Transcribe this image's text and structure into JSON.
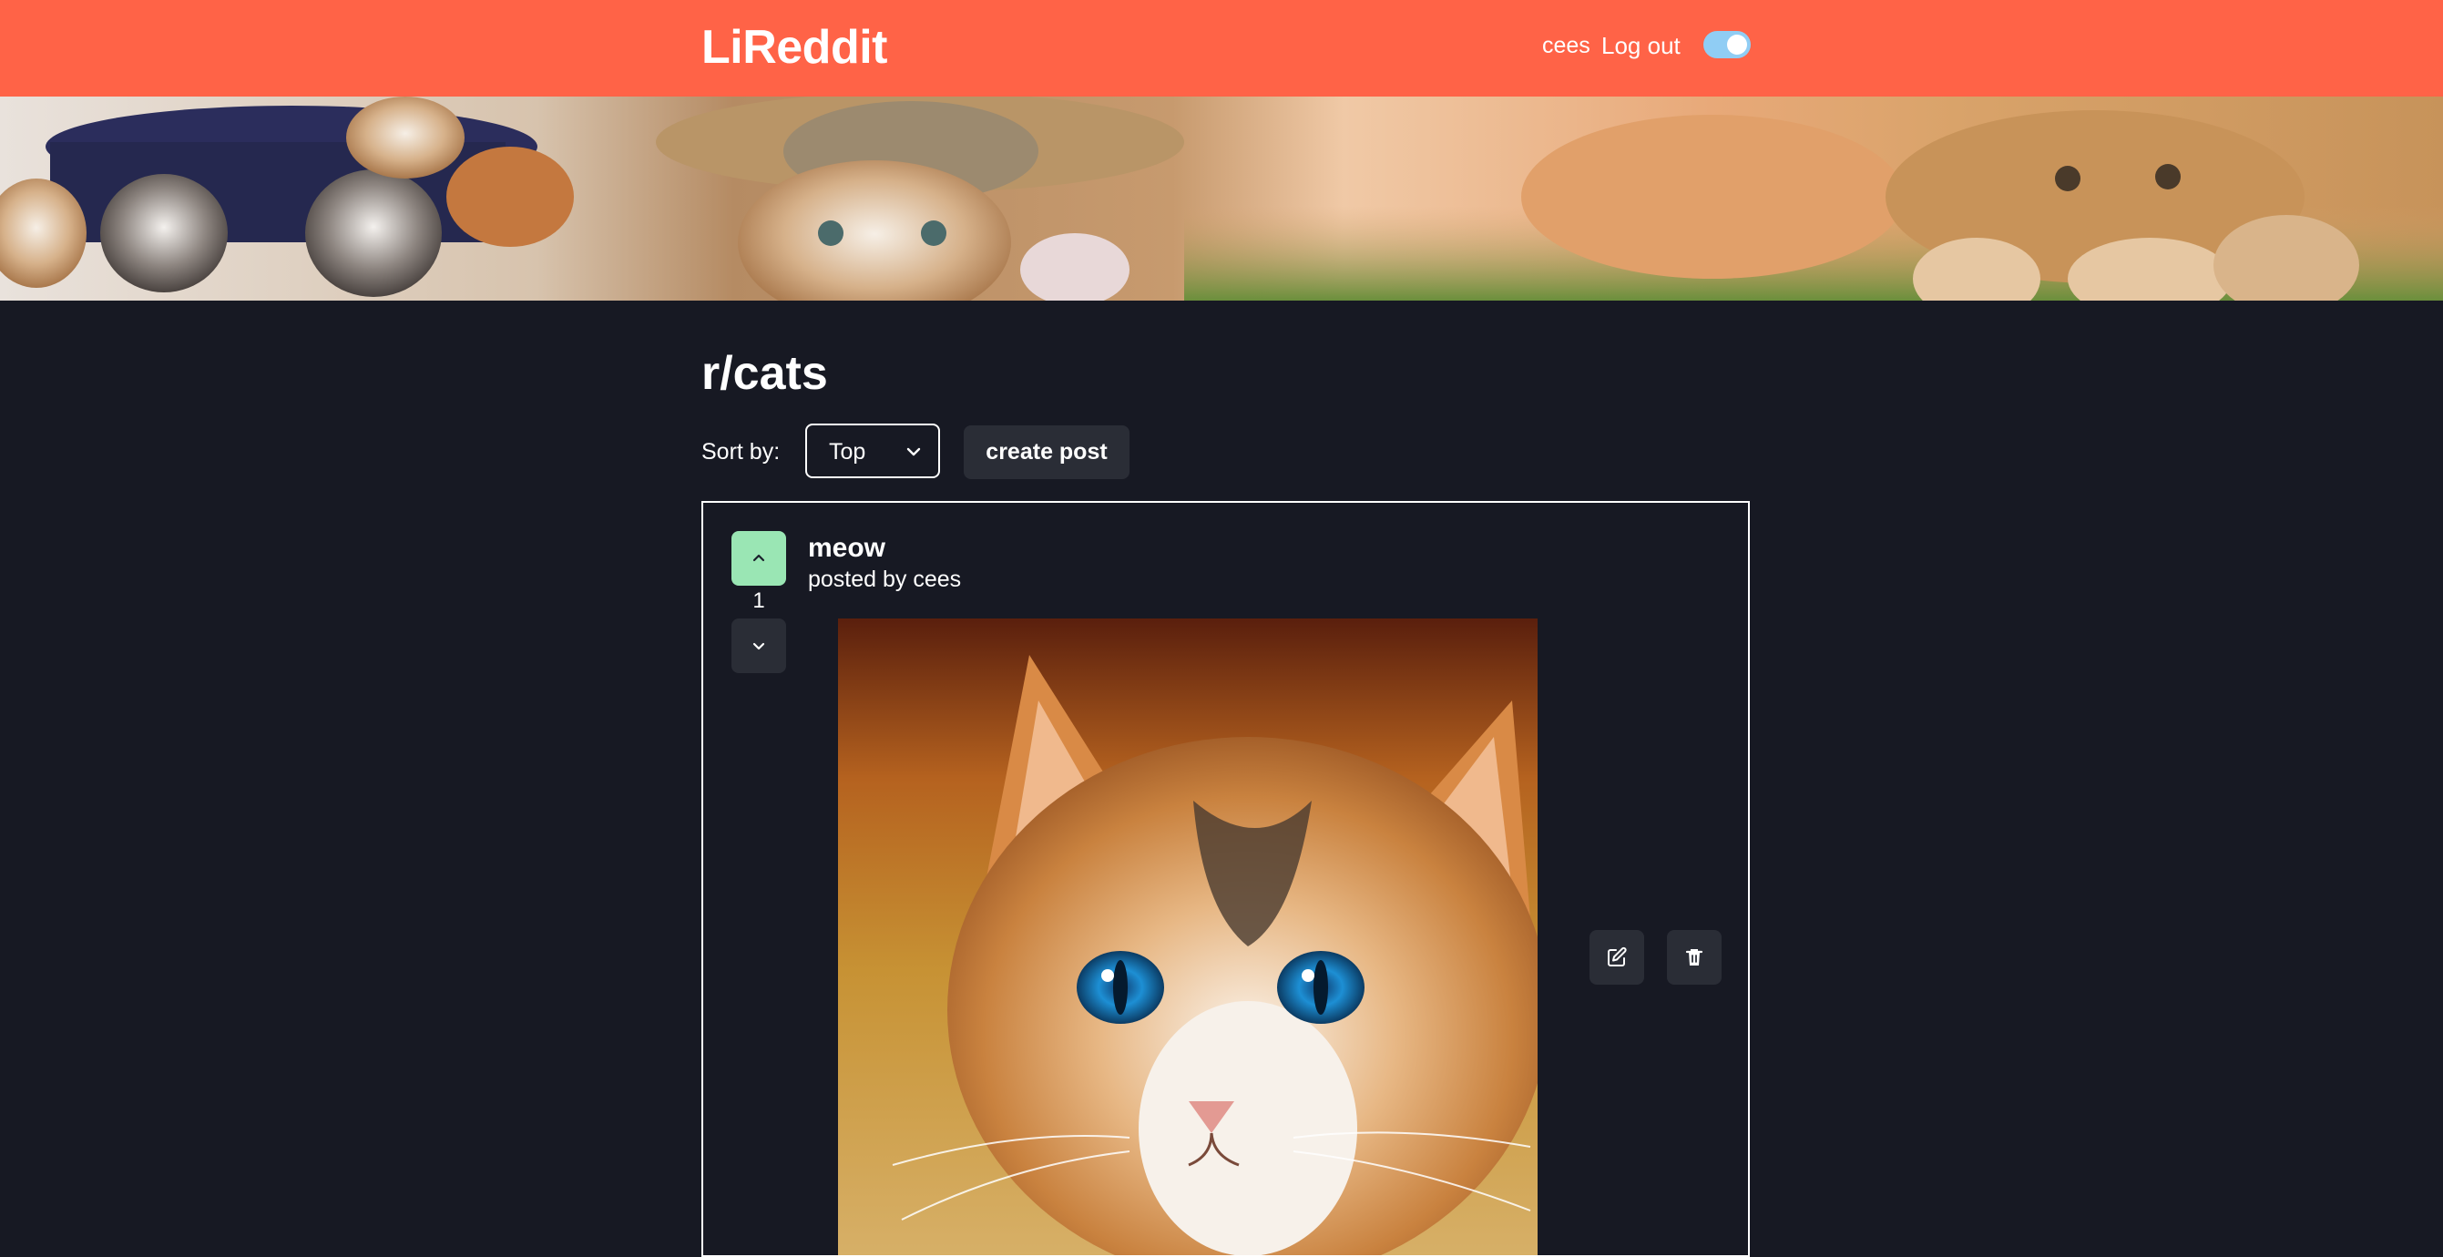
{
  "navbar": {
    "brand": "LiReddit",
    "username": "cees",
    "logout_label": "Log out",
    "theme_toggle_on": true
  },
  "banner": {
    "icon": "cats-banner-image"
  },
  "subreddit": {
    "title": "r/cats",
    "sort_label": "Sort by:",
    "sort_value": "Top",
    "create_post_label": "create post"
  },
  "posts": [
    {
      "title": "meow",
      "meta": "posted by cees",
      "votes": "1",
      "image_icon": "cat-painting-image"
    }
  ],
  "colors": {
    "navbar": "#ff6347",
    "background": "#171923",
    "upvote_active": "#9ae6b4",
    "button_bg": "#2a2d36",
    "toggle": "#90cdf4"
  }
}
